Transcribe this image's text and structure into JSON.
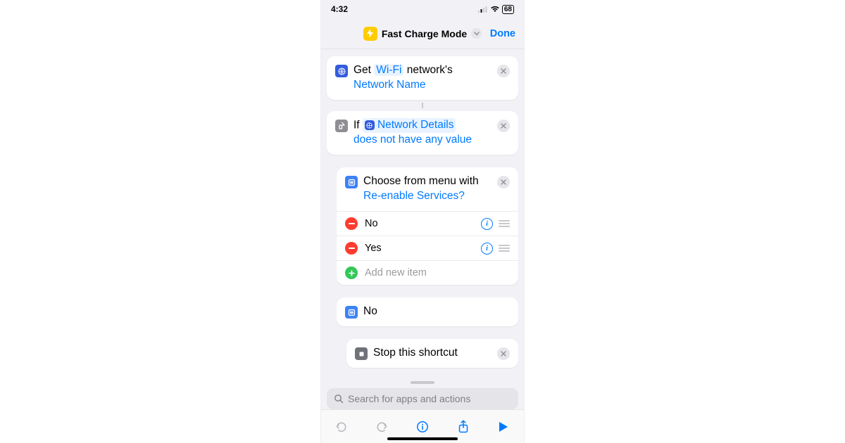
{
  "status": {
    "time": "4:32",
    "battery": "68"
  },
  "nav": {
    "title": "Fast Charge Mode",
    "done": "Done"
  },
  "actions": {
    "get": {
      "word_get": "Get",
      "token_wifi": "Wi-Fi",
      "word_networks": "network's",
      "token_netname": "Network Name"
    },
    "if": {
      "word_if": "If",
      "token_details": "Network Details",
      "cond": "does not have any value"
    },
    "menu": {
      "title_pre": "Choose from menu with",
      "prompt": "Re-enable Services?",
      "items": [
        "No",
        "Yes"
      ],
      "add_placeholder": "Add new item"
    },
    "no_case": {
      "label": "No"
    },
    "stop": {
      "label": "Stop this shortcut"
    }
  },
  "search": {
    "placeholder": "Search for apps and actions"
  }
}
